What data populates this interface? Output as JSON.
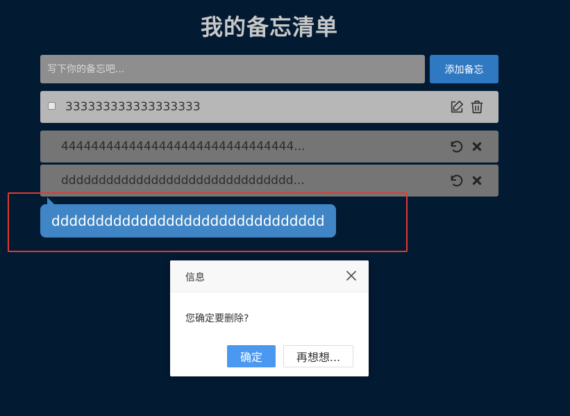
{
  "header": {
    "title": "我的备忘清单"
  },
  "new_note": {
    "placeholder": "写下你的备忘吧...",
    "add_label": "添加备忘"
  },
  "active_notes": [
    {
      "text": "333333333333333333",
      "checked": false
    }
  ],
  "done_notes": [
    {
      "text": "4444444444444444444444444444444..."
    },
    {
      "text": "ddddddddddddddddddddddddddddddd..."
    }
  ],
  "tooltip": {
    "text": "ddddddddddddddddddddddddddddddd"
  },
  "dialog": {
    "title": "信息",
    "message": "您确定要删除?",
    "ok_label": "确定",
    "cancel_label": "再想想..."
  },
  "colors": {
    "background": "#031a33",
    "accent": "#2f79c3",
    "tooltip": "#4086c6",
    "highlight_border": "#e03a30"
  },
  "icons": {
    "edit": "edit-icon",
    "delete": "trash-icon",
    "restore": "undo-icon",
    "remove": "close-icon",
    "dialog_close": "close-icon"
  }
}
